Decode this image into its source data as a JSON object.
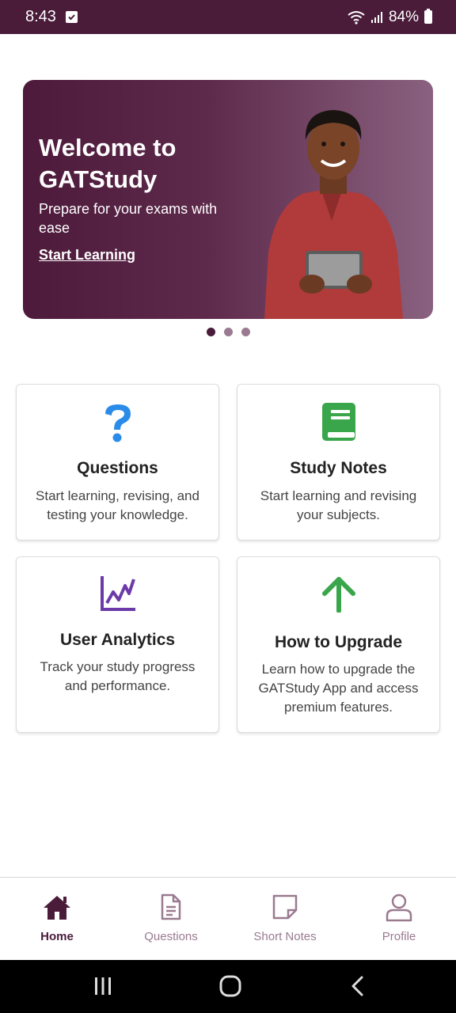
{
  "status_bar": {
    "time": "8:43",
    "battery": "84%"
  },
  "hero": {
    "title": "Welcome to GATStudy",
    "subtitle": "Prepare for your exams with ease",
    "link": "Start Learning"
  },
  "cards": {
    "questions": {
      "title": "Questions",
      "description": "Start learning, revising, and testing your knowledge.",
      "icon": "question-mark-icon"
    },
    "study_notes": {
      "title": "Study Notes",
      "description": "Start learning and revising your subjects.",
      "icon": "book-icon"
    },
    "analytics": {
      "title": "User Analytics",
      "description": "Track your study progress and performance.",
      "icon": "chart-icon"
    },
    "upgrade": {
      "title": "How to Upgrade",
      "description": "Learn how to upgrade the GATStudy App and access premium features.",
      "icon": "arrow-up-icon"
    }
  },
  "bottom_nav": {
    "items": [
      {
        "label": "Home",
        "icon": "home-icon",
        "active": true
      },
      {
        "label": "Questions",
        "icon": "document-icon",
        "active": false
      },
      {
        "label": "Short Notes",
        "icon": "note-icon",
        "active": false
      },
      {
        "label": "Profile",
        "icon": "person-icon",
        "active": false
      }
    ]
  },
  "colors": {
    "primary": "#4a1c3a",
    "questions_icon": "#2b8be8",
    "notes_icon": "#3aa64b",
    "analytics_icon": "#6b3aa8",
    "upgrade_icon": "#3aa64b",
    "inactive_nav": "#9a7a90"
  }
}
